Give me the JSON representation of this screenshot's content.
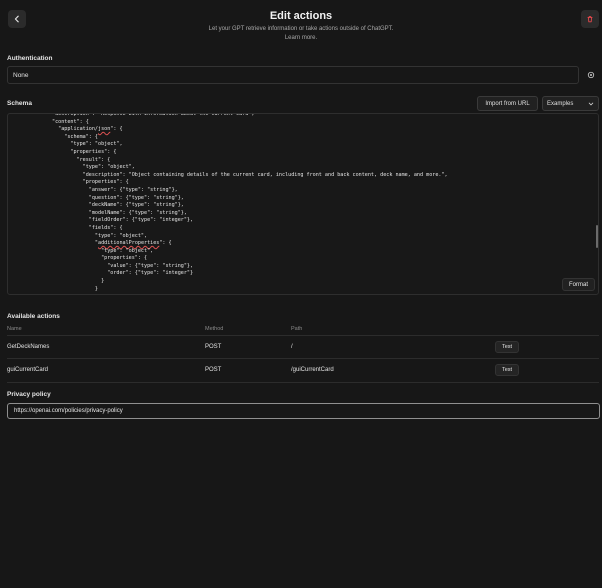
{
  "header": {
    "title": "Edit actions",
    "subtitle": "Let your GPT retrieve information or take actions outside of ChatGPT.",
    "learn_more": "Learn more."
  },
  "authentication": {
    "label": "Authentication",
    "value": "None"
  },
  "schema": {
    "label": "Schema",
    "import_button": "Import from URL",
    "examples_select": "Examples",
    "format_button": "Format",
    "code_lines": [
      "\"description\": \"Response with information about the current card\",",
      "\"content\": {",
      "  \"application/json\": {",
      "    \"schema\": {",
      "      \"type\": \"object\",",
      "      \"properties\": {",
      "        \"result\": {",
      "          \"type\": \"object\",",
      "          \"description\": \"Object containing details of the current card, including front and back content, deck name, and more.\",",
      "          \"properties\": {",
      "            \"answer\": {\"type\": \"string\"},",
      "            \"question\": {\"type\": \"string\"},",
      "            \"deckName\": {\"type\": \"string\"},",
      "            \"modelName\": {\"type\": \"string\"},",
      "            \"fieldOrder\": {\"type\": \"integer\"},",
      "            \"fields\": {",
      "              \"type\": \"object\",",
      "              \"additionalProperties\": {",
      "                \"type\": \"object\",",
      "                \"properties\": {",
      "                  \"value\": {\"type\": \"string\"},",
      "                  \"order\": {\"type\": \"integer\"}",
      "                }",
      "              }"
    ]
  },
  "actions": {
    "label": "Available actions",
    "columns": {
      "name": "Name",
      "method": "Method",
      "path": "Path"
    },
    "rows": [
      {
        "name": "GetDeckNames",
        "method": "POST",
        "path": "/",
        "test": "Test"
      },
      {
        "name": "guiCurrentCard",
        "method": "POST",
        "path": "/guiCurrentCard",
        "test": "Test"
      }
    ]
  },
  "privacy": {
    "label": "Privacy policy",
    "value": "https://openai.com/policies/privacy-policy"
  },
  "colors": {
    "background": "#171717",
    "delete_icon": "#e5484d"
  },
  "icons": {
    "back": "chevron-left-icon",
    "delete": "trash-icon",
    "settings": "gear-icon",
    "dropdown": "chevron-down-icon"
  }
}
